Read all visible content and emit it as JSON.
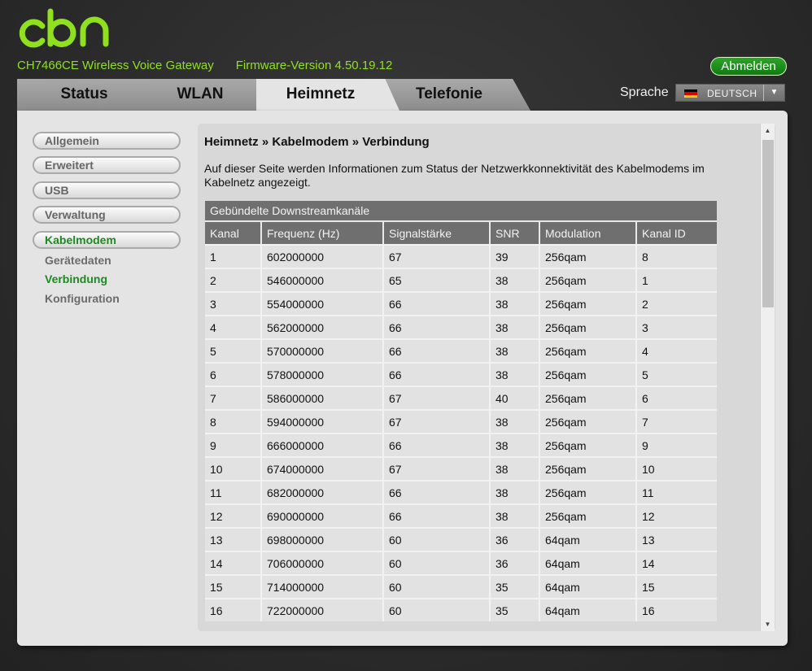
{
  "header": {
    "logo_text": "cbn",
    "product_name": "CH7466CE  Wireless Voice Gateway",
    "firmware": "Firmware-Version  4.50.19.12",
    "logout_label": "Abmelden",
    "brand_color": "#8fe01d"
  },
  "tabs": [
    {
      "label": "Status"
    },
    {
      "label": "WLAN"
    },
    {
      "label": "Heimnetz",
      "active": true
    },
    {
      "label": "Telefonie"
    }
  ],
  "language": {
    "label": "Sprache",
    "selected": "DEUTSCH",
    "flag_icon": "germany-flag-icon"
  },
  "sidebar": {
    "items": [
      {
        "label": "Allgemein"
      },
      {
        "label": "Erweitert"
      },
      {
        "label": "USB"
      },
      {
        "label": "Verwaltung"
      },
      {
        "label": "Kabelmodem",
        "active": true
      }
    ],
    "subitems": [
      {
        "label": "Gerätedaten"
      },
      {
        "label": "Verbindung",
        "active": true
      },
      {
        "label": "Konfiguration"
      }
    ]
  },
  "main": {
    "breadcrumb": "Heimnetz » Kabelmodem » Verbindung",
    "description": "Auf dieser Seite werden Informationen zum Status der Netzwerkkonnektivität des Kabelmodems im Kabelnetz angezeigt.",
    "table": {
      "caption": "Gebündelte Downstreamkanäle",
      "headers": [
        "Kanal",
        "Frequenz (Hz)",
        "Signalstärke",
        "SNR",
        "Modulation",
        "Kanal ID"
      ],
      "rows": [
        [
          "1",
          "602000000",
          "67",
          "39",
          "256qam",
          "8"
        ],
        [
          "2",
          "546000000",
          "65",
          "38",
          "256qam",
          "1"
        ],
        [
          "3",
          "554000000",
          "66",
          "38",
          "256qam",
          "2"
        ],
        [
          "4",
          "562000000",
          "66",
          "38",
          "256qam",
          "3"
        ],
        [
          "5",
          "570000000",
          "66",
          "38",
          "256qam",
          "4"
        ],
        [
          "6",
          "578000000",
          "66",
          "38",
          "256qam",
          "5"
        ],
        [
          "7",
          "586000000",
          "67",
          "40",
          "256qam",
          "6"
        ],
        [
          "8",
          "594000000",
          "67",
          "38",
          "256qam",
          "7"
        ],
        [
          "9",
          "666000000",
          "66",
          "38",
          "256qam",
          "9"
        ],
        [
          "10",
          "674000000",
          "67",
          "38",
          "256qam",
          "10"
        ],
        [
          "11",
          "682000000",
          "66",
          "38",
          "256qam",
          "11"
        ],
        [
          "12",
          "690000000",
          "66",
          "38",
          "256qam",
          "12"
        ],
        [
          "13",
          "698000000",
          "60",
          "36",
          "64qam",
          "13"
        ],
        [
          "14",
          "706000000",
          "60",
          "36",
          "64qam",
          "14"
        ],
        [
          "15",
          "714000000",
          "60",
          "35",
          "64qam",
          "15"
        ],
        [
          "16",
          "722000000",
          "60",
          "35",
          "64qam",
          "16"
        ]
      ]
    }
  }
}
